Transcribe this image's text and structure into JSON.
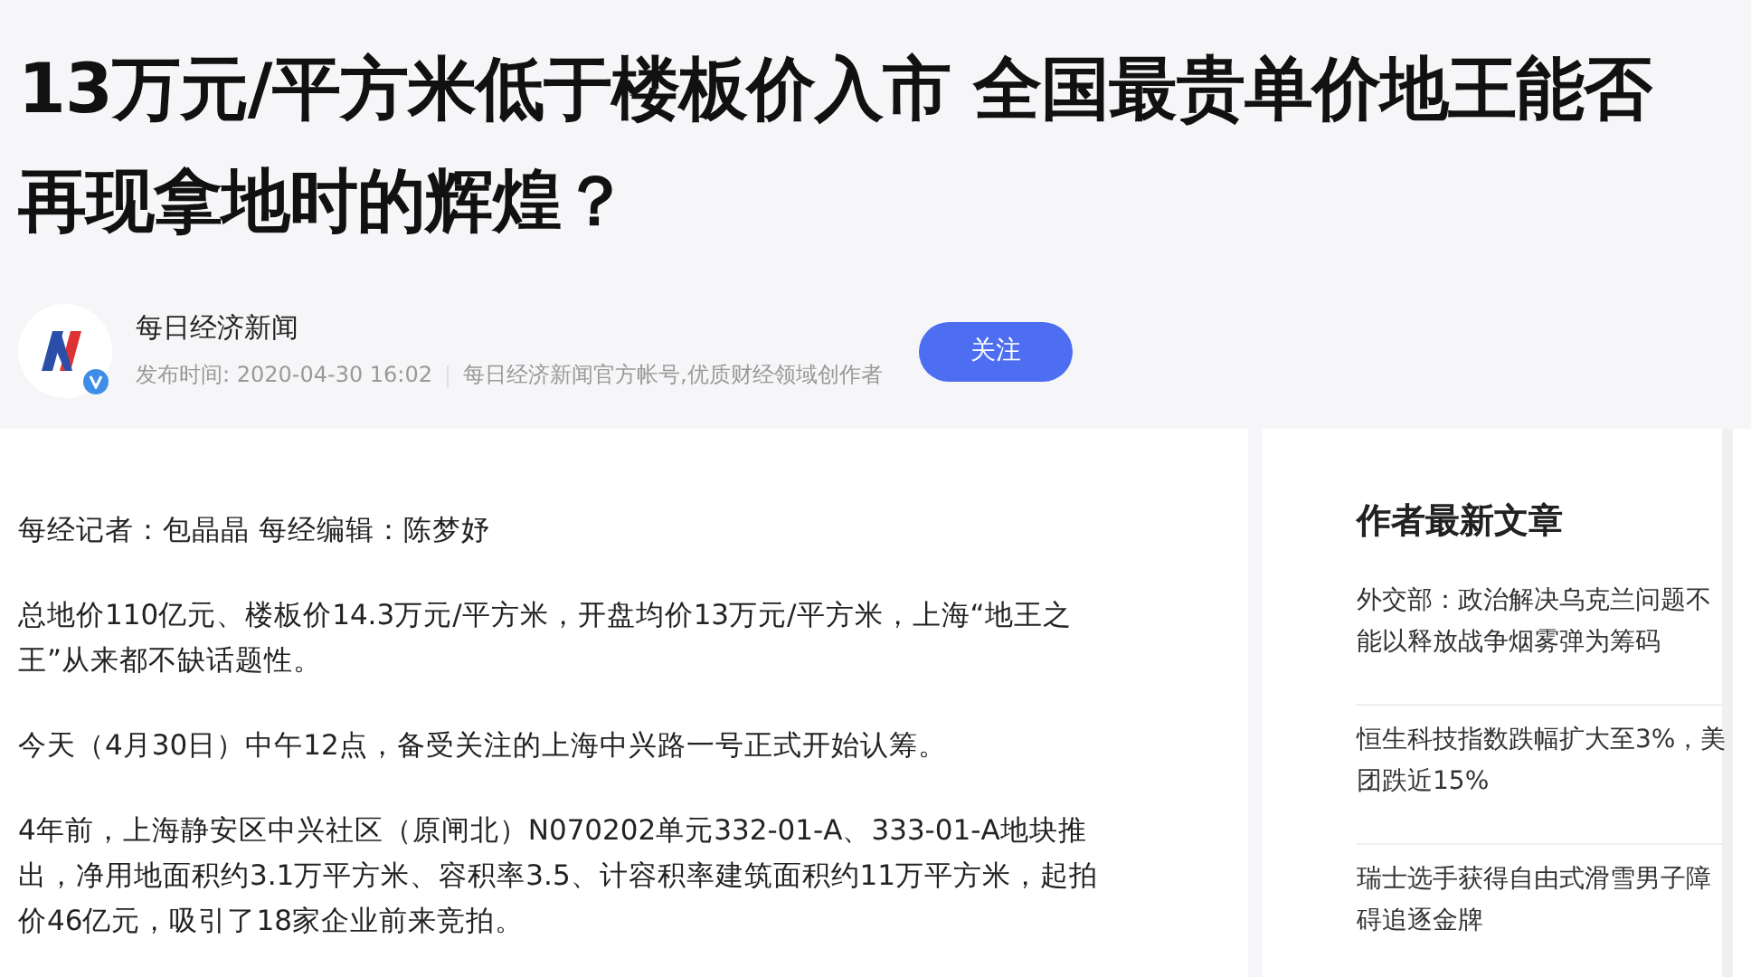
{
  "article": {
    "title": "13万元/平方米低于楼板价入市 全国最贵单价地王能否再现拿地时的辉煌？"
  },
  "author": {
    "name": "每日经济新闻",
    "verified": true,
    "publish_time": "发布时间: 2020-04-30 16:02",
    "description": "每日经济新闻官方帐号,优质财经领域创作者",
    "follow_button": "关注"
  },
  "paragraphs": [
    "每经记者：包晶晶 每经编辑：陈梦妤",
    "总地价110亿元、楼板价14.3万元/平方米，开盘均价13万元/平方米，上海“地王之王”从来都不缺话题性。",
    "今天（4月30日）中午12点，备受关注的上海中兴路一号正式开始认筹。",
    "4年前，上海静安区中兴社区（原闸北）N070202单元332-01-A、333-01-A地块推出，净用地面积约3.1万平方米、容积率3.5、计容积率建筑面积约11万平方米，起拍价46亿元，吸引了18家企业前来竞拍。"
  ],
  "sidebar": {
    "heading": "作者最新文章",
    "items": [
      "外交部：政治解决乌克兰问题不能以释放战争烟雾弹为筹码",
      "恒生科技指数跌幅扩大至3%，美团跌近15%",
      "瑞士选手获得自由式滑雪男子障碍追逐金牌"
    ]
  }
}
